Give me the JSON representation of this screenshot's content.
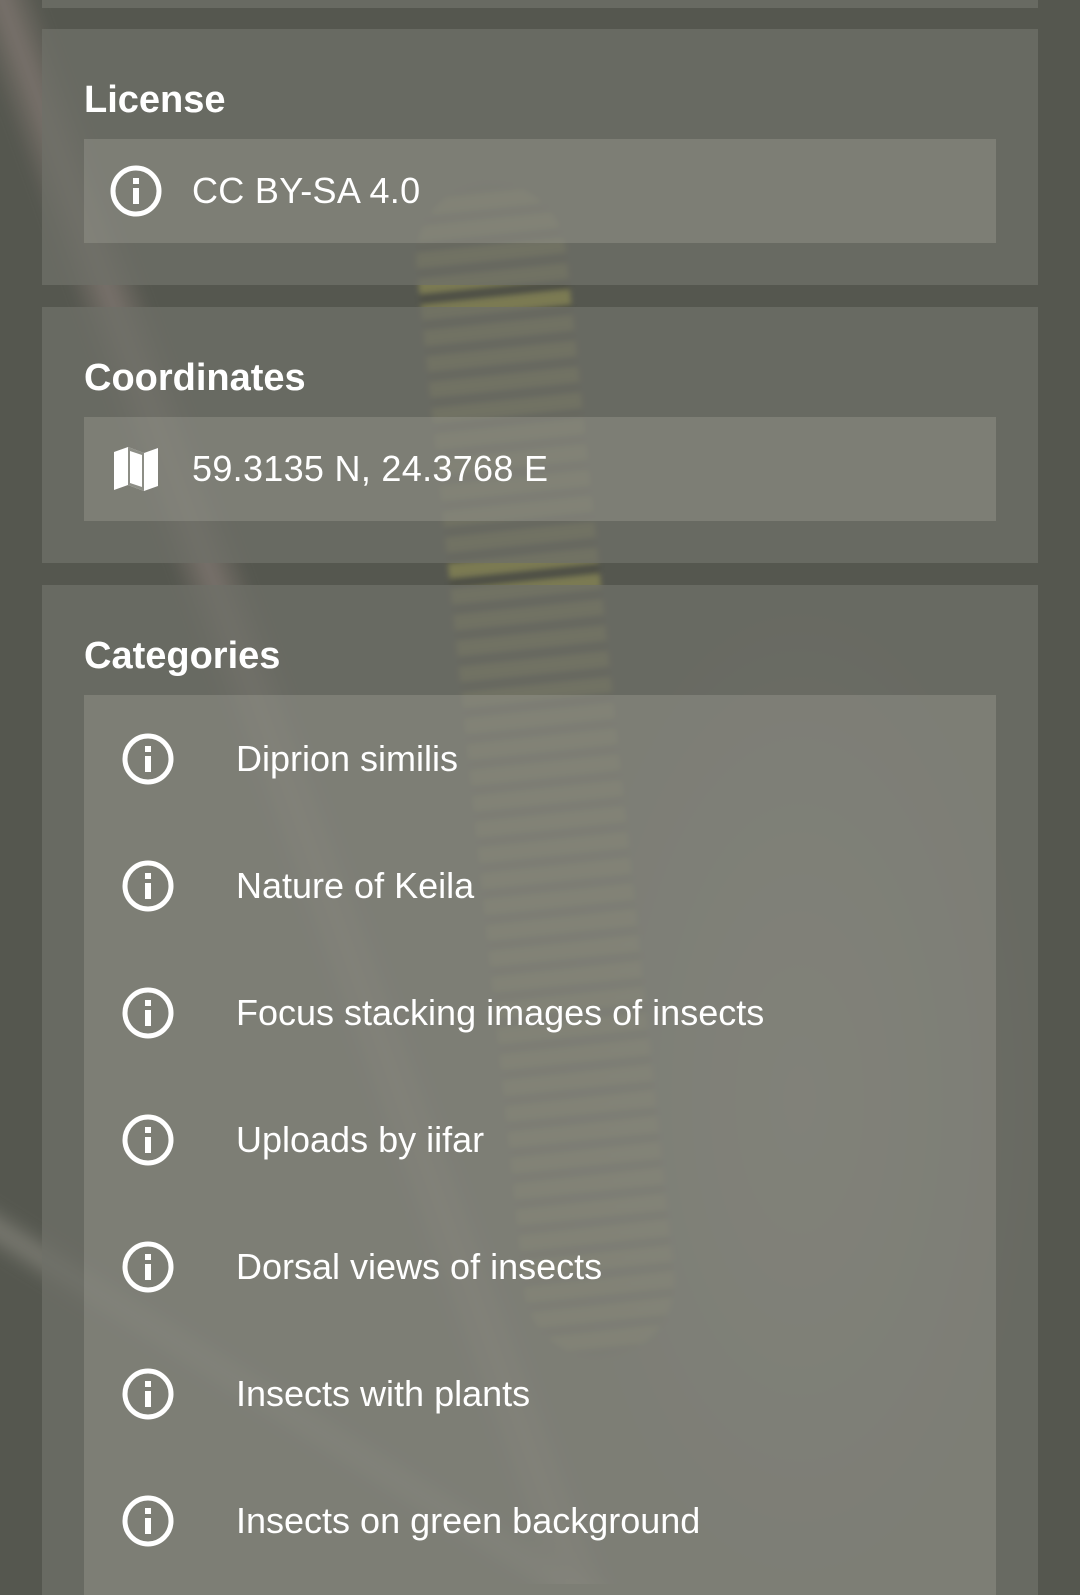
{
  "license": {
    "title": "License",
    "value": "CC BY-SA 4.0",
    "icon": "info-icon"
  },
  "coordinates": {
    "title": "Coordinates",
    "value": "59.3135 N, 24.3768 E",
    "icon": "map-icon"
  },
  "categories": {
    "title": "Categories",
    "items": [
      {
        "label": "Diprion similis",
        "icon": "info-icon"
      },
      {
        "label": "Nature of Keila",
        "icon": "info-icon"
      },
      {
        "label": "Focus stacking images of insects",
        "icon": "info-icon"
      },
      {
        "label": "Uploads by iifar",
        "icon": "info-icon"
      },
      {
        "label": "Dorsal views of insects",
        "icon": "info-icon"
      },
      {
        "label": "Insects with plants",
        "icon": "info-icon"
      },
      {
        "label": "Insects on green background",
        "icon": "info-icon"
      }
    ]
  },
  "colors": {
    "background": "#55574f",
    "card": "#6e7068",
    "text": "#ffffff"
  }
}
